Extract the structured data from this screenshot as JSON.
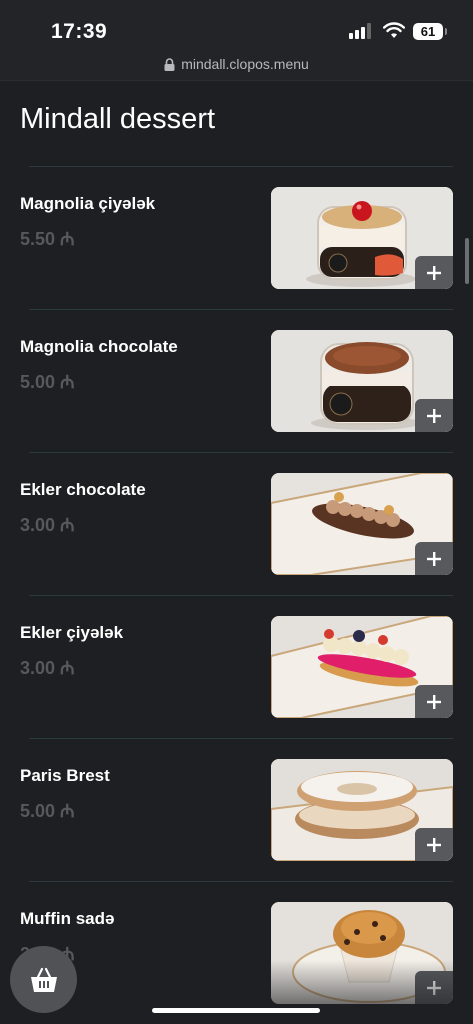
{
  "status_bar": {
    "time": "17:39",
    "battery": "61"
  },
  "browser": {
    "url": "mindall.clopos.menu"
  },
  "page": {
    "title": "Mindall dessert"
  },
  "items": [
    {
      "name": "Magnolia çiyələk",
      "price": "5.50 ₼",
      "image_icon": "strawberry-jar-dessert"
    },
    {
      "name": "Magnolia chocolate",
      "price": "5.00 ₼",
      "image_icon": "chocolate-jar-dessert"
    },
    {
      "name": "Ekler chocolate",
      "price": "3.00 ₼",
      "image_icon": "chocolate-eclair"
    },
    {
      "name": "Ekler çiyələk",
      "price": "3.00 ₼",
      "image_icon": "strawberry-eclair"
    },
    {
      "name": "Paris Brest",
      "price": "5.00 ₼",
      "image_icon": "paris-brest-pastry"
    },
    {
      "name": "Muffin sadə",
      "price": "2.50 ₼",
      "image_icon": "muffin"
    }
  ],
  "icons": {
    "add": "plus-icon",
    "cart": "basket-icon"
  },
  "colors": {
    "background": "#1e1f22",
    "price": "#55585c",
    "add_button": "#57595c"
  }
}
